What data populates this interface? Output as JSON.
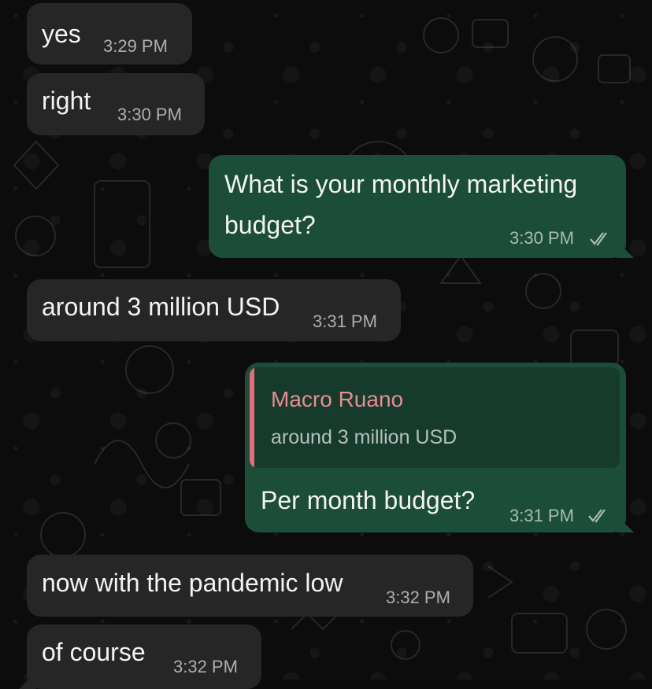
{
  "messages": [
    {
      "id": "m1",
      "direction": "incoming",
      "text": "yes",
      "time": "3:29 PM"
    },
    {
      "id": "m2",
      "direction": "incoming",
      "text": "right",
      "time": "3:30 PM"
    },
    {
      "id": "m3",
      "direction": "outgoing",
      "text_line1": "What is your monthly marketing",
      "text_line2": "budget?",
      "time": "3:30 PM",
      "status": "read"
    },
    {
      "id": "m4",
      "direction": "incoming",
      "text": "around 3 million USD",
      "time": "3:31 PM"
    },
    {
      "id": "m5",
      "direction": "outgoing",
      "quoted_author": "Macro Ruano",
      "quoted_text": "around 3 million USD",
      "text": "Per month budget?",
      "time": "3:31 PM",
      "status": "read"
    },
    {
      "id": "m6",
      "direction": "incoming",
      "text": "now with the pandemic low",
      "time": "3:32 PM"
    },
    {
      "id": "m7",
      "direction": "incoming",
      "text": "of course",
      "time": "3:32 PM"
    }
  ],
  "colors": {
    "incoming_bubble": "#262626",
    "outgoing_bubble": "#1b4d39",
    "quote_bar": "#e56c7b",
    "quote_author": "#e98b92",
    "chat_background": "#0c0c0c"
  }
}
